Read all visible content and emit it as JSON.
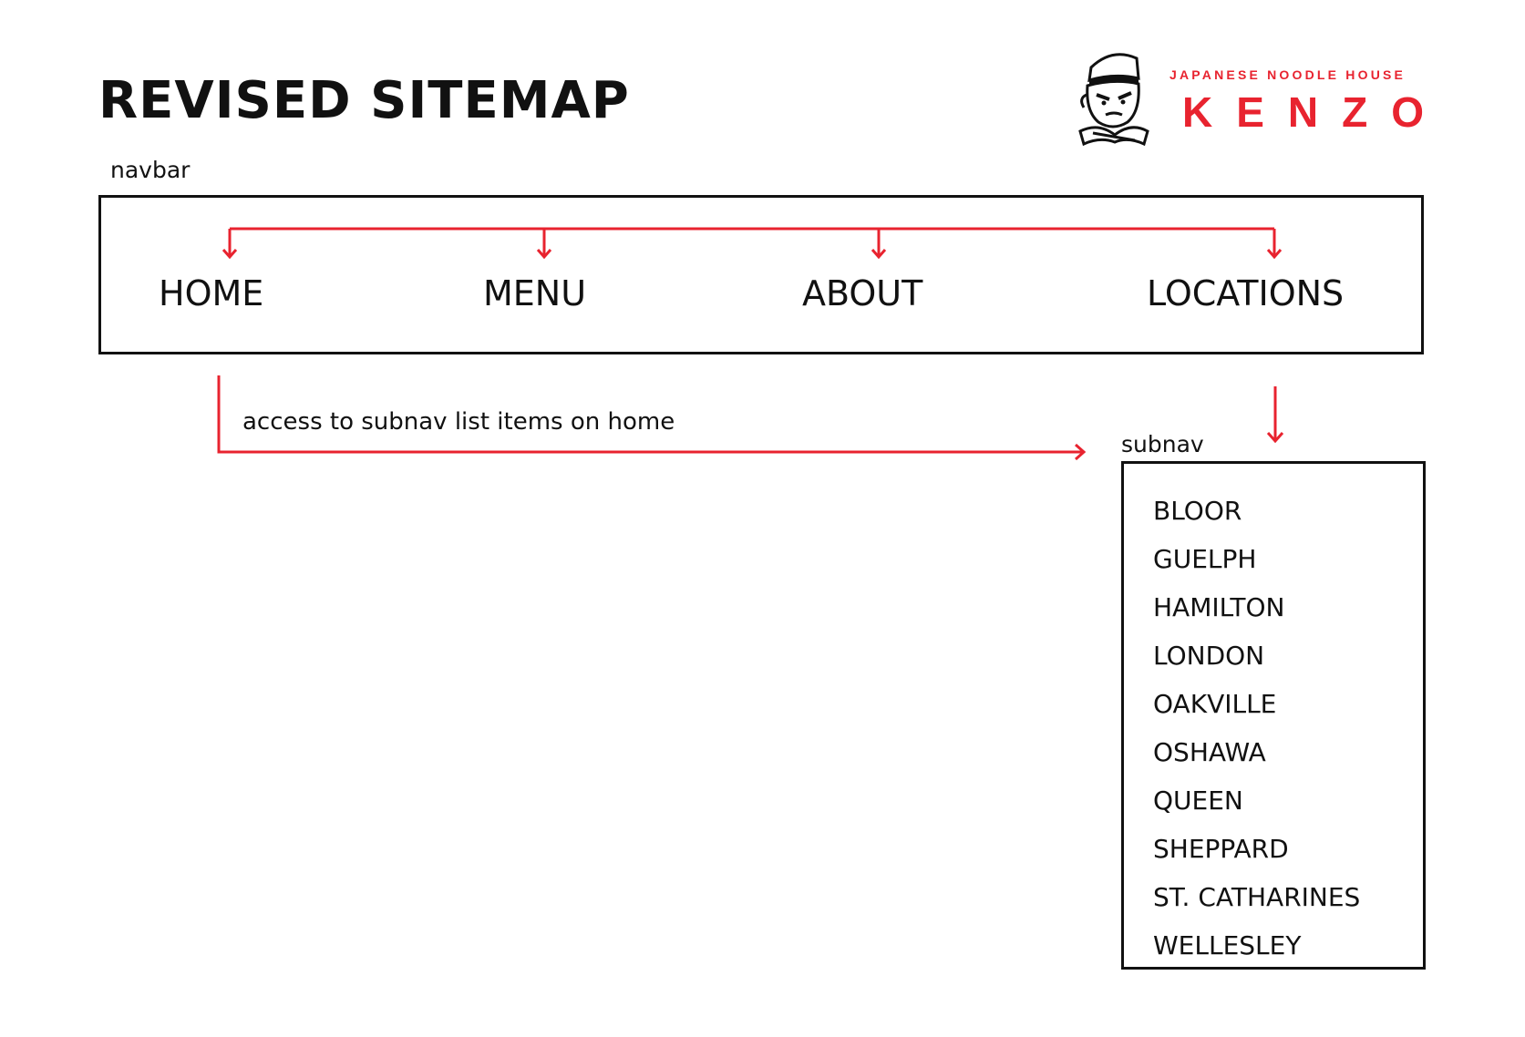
{
  "title": "REVISED SITEMAP",
  "logo": {
    "tagline": "JAPANESE NOODLE HOUSE",
    "name": "KENZO",
    "icon": "chef-mascot-icon",
    "color": "#e8232f"
  },
  "navbar": {
    "label": "navbar",
    "items": [
      "HOME",
      "MENU",
      "ABOUT",
      "LOCATIONS"
    ]
  },
  "annotation": "access to subnav list items on home",
  "subnav": {
    "label": "subnav",
    "items": [
      "BLOOR",
      "GUELPH",
      "HAMILTON",
      "LONDON",
      "OAKVILLE",
      "OSHAWA",
      "QUEEN",
      "SHEPPARD",
      "ST. CATHARINES",
      "WELLESLEY"
    ]
  },
  "colors": {
    "connector": "#e8232f",
    "text": "#111111",
    "border": "#111111"
  }
}
